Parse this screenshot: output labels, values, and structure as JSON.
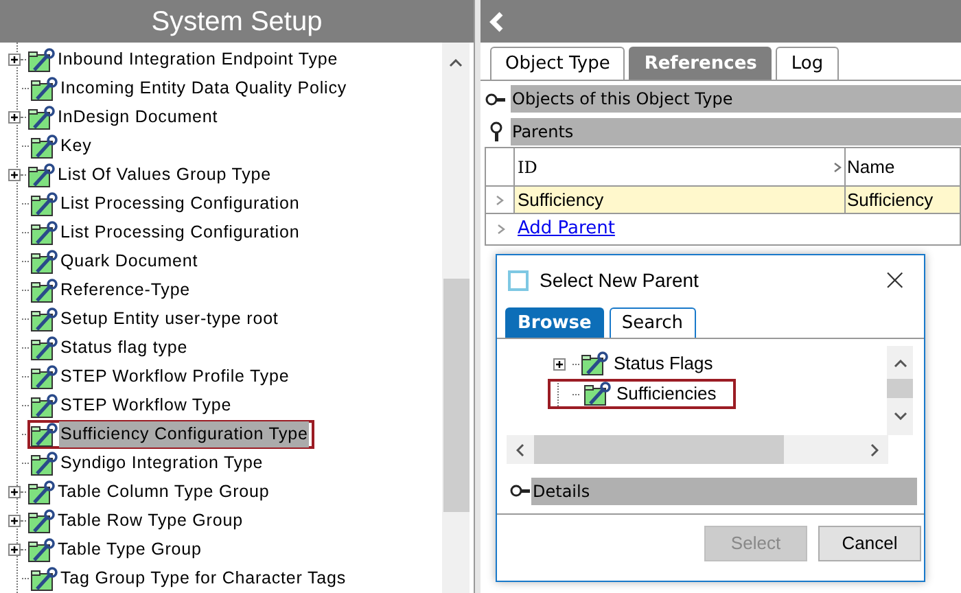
{
  "left_panel": {
    "title": "System Setup",
    "tree": [
      {
        "label": "Inbound Integration Endpoint Type",
        "expandable": true,
        "selected": false
      },
      {
        "label": "Incoming Entity Data Quality Policy",
        "expandable": false,
        "selected": false
      },
      {
        "label": "InDesign Document",
        "expandable": true,
        "selected": false
      },
      {
        "label": "Key",
        "expandable": false,
        "selected": false
      },
      {
        "label": "List Of Values Group Type",
        "expandable": true,
        "selected": false
      },
      {
        "label": "List Processing Configuration",
        "expandable": false,
        "selected": false
      },
      {
        "label": "List Processing Configuration",
        "expandable": false,
        "selected": false
      },
      {
        "label": "Quark Document",
        "expandable": false,
        "selected": false
      },
      {
        "label": "Reference-Type",
        "expandable": false,
        "selected": false
      },
      {
        "label": "Setup Entity user-type root",
        "expandable": false,
        "selected": false
      },
      {
        "label": "Status flag type",
        "expandable": false,
        "selected": false
      },
      {
        "label": "STEP Workflow Profile Type",
        "expandable": false,
        "selected": false
      },
      {
        "label": "STEP Workflow Type",
        "expandable": false,
        "selected": false
      },
      {
        "label": "Sufficiency Configuration Type",
        "expandable": false,
        "selected": true
      },
      {
        "label": "Syndigo Integration Type",
        "expandable": false,
        "selected": false
      },
      {
        "label": "Table Column Type Group",
        "expandable": true,
        "selected": false
      },
      {
        "label": "Table Row Type Group",
        "expandable": true,
        "selected": false
      },
      {
        "label": "Table Type Group",
        "expandable": true,
        "selected": false
      },
      {
        "label": "Tag Group Type for Character Tags",
        "expandable": false,
        "selected": false
      }
    ]
  },
  "right_panel": {
    "tabs": [
      {
        "label": "Object Type",
        "selected": false
      },
      {
        "label": "References",
        "selected": true
      },
      {
        "label": "Log",
        "selected": false
      }
    ],
    "sections": [
      {
        "title": "Objects of this  Object Type",
        "kind": "collapsed"
      },
      {
        "title": "Parents",
        "kind": "pinned"
      }
    ],
    "table": {
      "columns": [
        "ID",
        "Name"
      ],
      "rows": [
        {
          "cells": [
            "Sufficiency",
            "Sufficiency"
          ],
          "selected": true
        }
      ],
      "add_link": "Add Parent"
    }
  },
  "dialog": {
    "title": "Select New Parent",
    "close": "×",
    "tabs": [
      {
        "label": "Browse",
        "selected": true
      },
      {
        "label": "Search",
        "selected": false
      }
    ],
    "tree": [
      {
        "label": "Status Flags",
        "expandable": true,
        "selected": false
      },
      {
        "label": "Sufficiencies",
        "expandable": false,
        "selected": true
      }
    ],
    "details": "Details",
    "buttons": [
      {
        "label": "Select",
        "disabled": true
      },
      {
        "label": "Cancel",
        "disabled": false
      }
    ]
  }
}
